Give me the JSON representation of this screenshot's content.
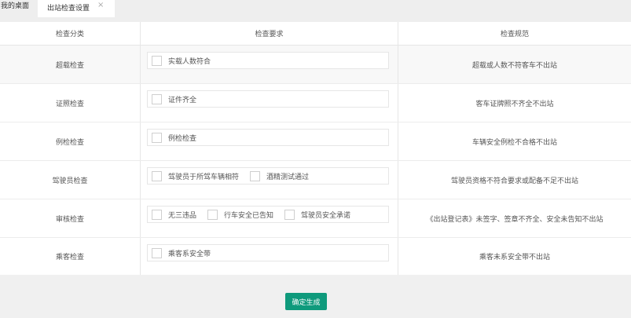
{
  "tabs": {
    "home": "我的桌面",
    "active": "出站检查设置",
    "close": "×"
  },
  "table": {
    "headers": [
      "检查分类",
      "检查要求",
      "检查规范"
    ],
    "rows": [
      {
        "category": "超载检查",
        "options": [
          "实载人数符合"
        ],
        "rule": "超载或人数不符客车不出站"
      },
      {
        "category": "证照检查",
        "options": [
          "证件齐全"
        ],
        "rule": "客车证牌照不齐全不出站"
      },
      {
        "category": "例检检查",
        "options": [
          "例检检查"
        ],
        "rule": "车辆安全例检不合格不出站"
      },
      {
        "category": "驾驶员检查",
        "options": [
          "驾驶员于所驾车辆相符",
          "酒精测试通过"
        ],
        "rule": "驾驶员资格不符合要求或配备不足不出站"
      },
      {
        "category": "审核检查",
        "options": [
          "无三违品",
          "行车安全已告知",
          "驾驶员安全承诺"
        ],
        "rule": "《出站登记表》未签字、签章不齐全、安全未告知不出站"
      },
      {
        "category": "乘客检查",
        "options": [
          "乘客系安全带"
        ],
        "rule": "乘客未系安全带不出站"
      }
    ]
  },
  "footer": {
    "confirm_label": "确定生成"
  },
  "colors": {
    "accent": "#0f9a7c"
  }
}
